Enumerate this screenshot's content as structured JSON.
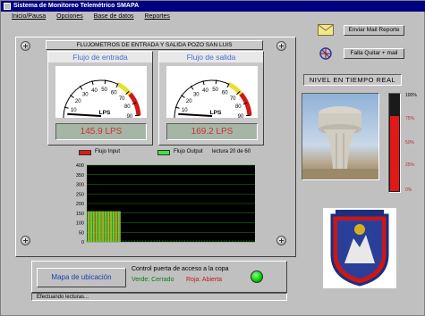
{
  "window": {
    "title": "Sistema de Monitoreo Telemétrico SMAPA"
  },
  "menu": {
    "items": [
      "Inicio/Pausa",
      "Opciones",
      "Base de datos",
      "Reportes"
    ]
  },
  "meters_panel": {
    "title": "FLUJOMETROS DE ENTRADA Y SALIDA POZO SAN LUIS",
    "inlet": {
      "title": "Flujo de entrada",
      "unit": "LPS",
      "scale": [
        "0",
        "10",
        "20",
        "30",
        "40",
        "50",
        "60",
        "70",
        "80",
        "90"
      ],
      "needle_value": 5,
      "max": 90,
      "readout": "145.9 LPS"
    },
    "outlet": {
      "title": "Flujo de salida",
      "unit": "LPS",
      "scale": [
        "0",
        "10",
        "20",
        "30",
        "40",
        "50",
        "60",
        "70",
        "80",
        "90"
      ],
      "needle_value": 5,
      "max": 90,
      "readout": "169.2 LPS"
    }
  },
  "legend": {
    "input_label": "Flujo Input",
    "output_label": "Flujo Output",
    "reading_text": "lectura 20 de 60",
    "input_color": "#e01818",
    "output_color": "#40e040"
  },
  "chart_data": {
    "type": "bar",
    "ylim": [
      0,
      400
    ],
    "yticks": [
      "400",
      "350",
      "300",
      "250",
      "200",
      "150",
      "100",
      "50",
      "0"
    ],
    "bar_value": 160,
    "bar_count": 12,
    "total_slots": 60,
    "colors": {
      "input": "#e01818",
      "output": "#40e040",
      "background": "#000000",
      "grid": "#1a8a1a"
    }
  },
  "actions": {
    "email_button": "Enviar Mail Reporte",
    "fail_button": "Falla Quitar + mail"
  },
  "level": {
    "title": "NIVEL EN TIEMPO REAL",
    "ticks": [
      "100%",
      "75%",
      "50%",
      "25%",
      "0%"
    ],
    "value_percent": 78,
    "color": "#e01818"
  },
  "map_button": "Mapa de ubicación",
  "valve": {
    "title": "Control puerta de acceso a la copa",
    "green_label": "Verde: Cerrado",
    "red_label": "Roja: Abierta",
    "state_color": "#00cc00"
  },
  "status": {
    "text": "Efectuando lecturas..."
  }
}
